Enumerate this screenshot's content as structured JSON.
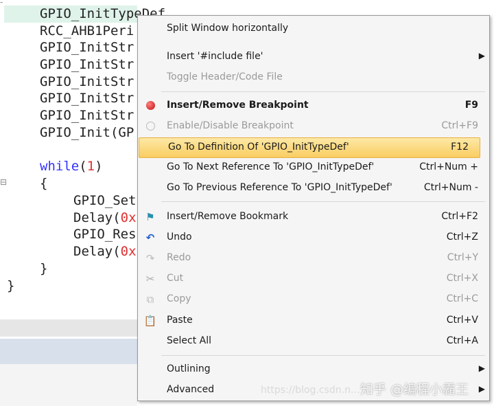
{
  "code": {
    "lines": [
      {
        "text": "GPIO_InitTypeDef GPIO_InitStructure;",
        "indent": 1
      },
      {
        "text": "RCC_AHB1Peri",
        "indent": 1
      },
      {
        "text": "GPIO_InitStr",
        "indent": 1
      },
      {
        "text": "GPIO_InitStr",
        "indent": 1
      },
      {
        "text": "GPIO_InitStr",
        "indent": 1
      },
      {
        "text": "GPIO_InitStr",
        "indent": 1
      },
      {
        "text": "GPIO_InitStr",
        "indent": 1
      },
      {
        "text": "GPIO_Init(GP",
        "indent": 1
      },
      {
        "text": "",
        "indent": 1
      },
      {
        "kw": "while",
        "paren_open": "(",
        "num": "1",
        "paren_close": ")",
        "indent": 1
      },
      {
        "text": "{",
        "indent": 1
      },
      {
        "text": "GPIO_Set",
        "indent": 2
      },
      {
        "text": "Delay(",
        "num": "0x",
        "indent": 2
      },
      {
        "text": "GPIO_Res",
        "indent": 2
      },
      {
        "text": "Delay(",
        "num": "0x",
        "indent": 2
      },
      {
        "text": "}",
        "indent": 1
      },
      {
        "text": "}",
        "indent": 0
      }
    ]
  },
  "menu": {
    "items": [
      {
        "label": "Split Window horizontally"
      },
      {
        "label": "Insert '#include file'",
        "submenu": "▶"
      },
      {
        "label": "Toggle Header/Code File",
        "disabled": true
      },
      {
        "label": "Insert/Remove Breakpoint",
        "shortcut": "F9",
        "icon": "breakpoint-icon",
        "bold": true
      },
      {
        "label": "Enable/Disable Breakpoint",
        "shortcut": "Ctrl+F9",
        "icon": "breakpoint-toggle-icon",
        "disabled": true
      },
      {
        "label": "Go To Definition Of 'GPIO_InitTypeDef'",
        "shortcut": "F12",
        "highlighted": true
      },
      {
        "label": "Go To Next Reference To 'GPIO_InitTypeDef'",
        "shortcut": "Ctrl+Num +"
      },
      {
        "label": "Go To Previous Reference To 'GPIO_InitTypeDef'",
        "shortcut": "Ctrl+Num -"
      },
      {
        "label": "Insert/Remove Bookmark",
        "shortcut": "Ctrl+F2",
        "icon": "bookmark-flag-icon"
      },
      {
        "label": "Undo",
        "shortcut": "Ctrl+Z",
        "icon": "undo-icon"
      },
      {
        "label": "Redo",
        "shortcut": "Ctrl+Y",
        "icon": "redo-icon",
        "disabled": true
      },
      {
        "label": "Cut",
        "shortcut": "Ctrl+X",
        "icon": "cut-icon",
        "disabled": true
      },
      {
        "label": "Copy",
        "shortcut": "Ctrl+C",
        "icon": "copy-icon",
        "disabled": true
      },
      {
        "label": "Paste",
        "shortcut": "Ctrl+V",
        "icon": "paste-icon"
      },
      {
        "label": "Select All",
        "shortcut": "Ctrl+A"
      },
      {
        "label": "Outlining",
        "submenu": "▶"
      },
      {
        "label": "Advanced",
        "submenu": "▶"
      }
    ]
  },
  "watermark": {
    "text": "知乎 @编程小霸王",
    "url": "https://blog.csdn.n…"
  },
  "colors": {
    "highlight": "#f9cd61",
    "breakpoint": "#d42020",
    "keyword": "#3333ff",
    "number": "#e03030"
  }
}
